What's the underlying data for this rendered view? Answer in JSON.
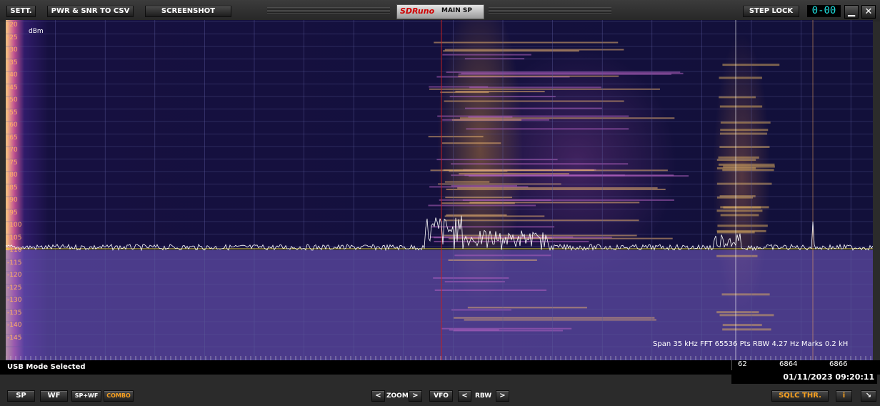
{
  "toolbar": {
    "sett": "SETT.",
    "pwr_snr_csv": "PWR & SNR TO CSV",
    "screenshot": "SCREENSHOT",
    "logo": "SDRuno",
    "panel_title": "MAIN SP",
    "step_lock": "STEP LOCK",
    "digits": "0-00",
    "minimize": "▁",
    "close": "✕"
  },
  "spectrum": {
    "unit_label": "dBm",
    "y_ticks": [
      "-20",
      "-25",
      "-30",
      "-35",
      "-40",
      "-45",
      "-50",
      "-55",
      "-60",
      "-65",
      "-70",
      "-75",
      "-80",
      "-85",
      "-90",
      "-95",
      "-100",
      "-105",
      "-110",
      "-115",
      "-120",
      "-125",
      "-130",
      "-135",
      "-140",
      "-145"
    ],
    "info_text": "Span 35 kHz   FFT 65536 Pts   RBW 4.27 Hz   Marks 0.2 kH",
    "freq_labels": [
      "62",
      "6864",
      "6866"
    ],
    "colors": {
      "trace": "#ffffff",
      "baseline": "#e0d030",
      "marker": "#c02020",
      "grid": "#5a5a9a",
      "ylabel": "#ffb066"
    }
  },
  "status": {
    "mode": "USB Mode Selected",
    "datetime": "01/11/2023 09:20:11"
  },
  "bottom": {
    "sp": "SP",
    "wf": "WF",
    "sp_wf": "SP+WF",
    "combo": "COMBO",
    "zoom": "ZOOM",
    "vfo": "VFO",
    "rbw": "RBW",
    "left_arrow": "<",
    "right_arrow": ">",
    "sqlc": "SQLC THR.",
    "info": "i",
    "resize": "↘"
  }
}
